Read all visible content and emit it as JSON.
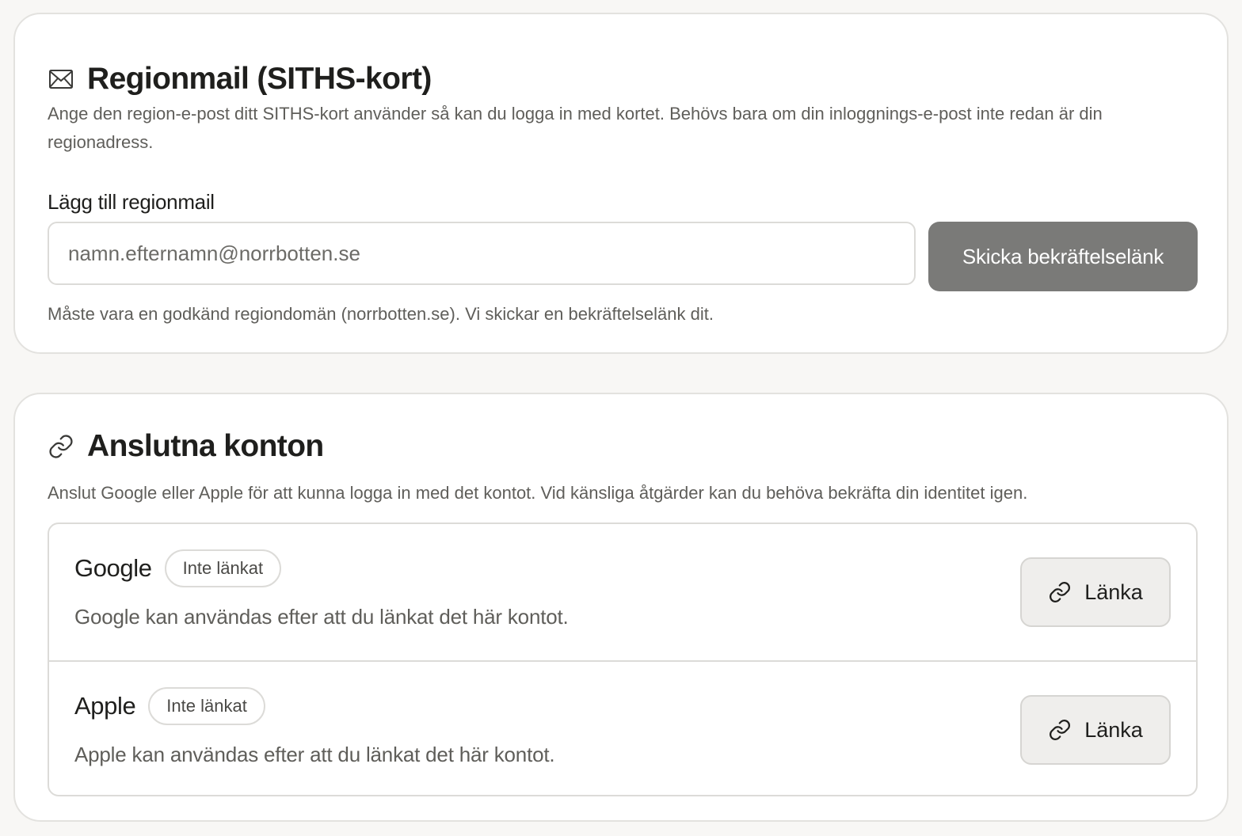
{
  "region_section": {
    "icon": "mail-icon",
    "title": "Regionmail (SITHS-kort)",
    "description": "Ange den region-e-post ditt SITHS-kort använder så kan du logga in med kortet. Behövs bara om din inloggnings-e-post inte redan är din regionadress.",
    "field_label": "Lägg till regionmail",
    "input_value": "",
    "input_placeholder": "namn.efternamn@norrbotten.se",
    "send_button_label": "Skicka bekräftelselänk",
    "hint": "Måste vara en godkänd regiondomän (norrbotten.se). Vi skickar en bekräftelselänk dit."
  },
  "accounts_section": {
    "icon": "link-icon",
    "title": "Anslutna konton",
    "description": "Anslut Google eller Apple för att kunna logga in med det kontot. Vid känsliga åtgärder kan du behöva bekräfta din identitet igen.",
    "providers": [
      {
        "name": "Google",
        "status": "Inte länkat",
        "description": "Google kan användas efter att du länkat det här kontot.",
        "button_label": "Länka",
        "button_icon": "link-icon"
      },
      {
        "name": "Apple",
        "status": "Inte länkat",
        "description": "Apple kan användas efter att du länkat det här kontot.",
        "button_label": "Länka",
        "button_icon": "link-icon"
      }
    ]
  },
  "colors": {
    "background": "#f8f7f5",
    "card": "#ffffff",
    "border": "#dcdbd8",
    "primary_button": "#7a7a78",
    "secondary_button": "#efeeec",
    "text": "#1f1f1d",
    "muted_text": "#5f5e5a"
  }
}
